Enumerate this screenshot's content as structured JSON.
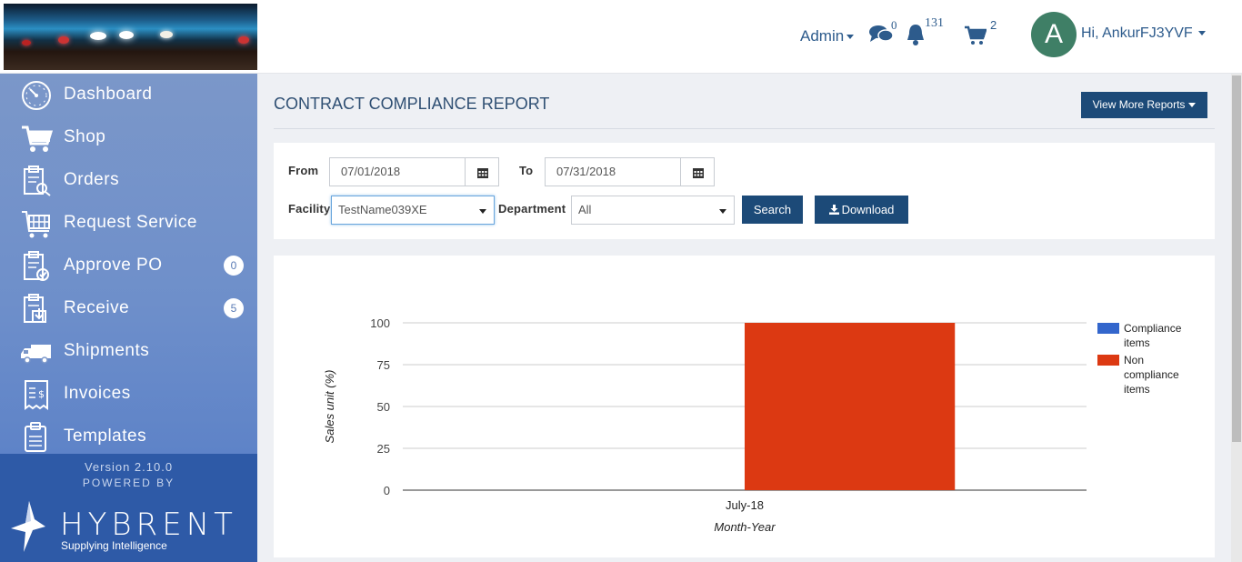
{
  "header": {
    "admin_label": "Admin",
    "messages_count": "0",
    "notifications_count": "131",
    "cart_count": "2",
    "avatar_initial": "A",
    "greeting": "Hi, AnkurFJ3YVF"
  },
  "sidebar": {
    "items": [
      {
        "label": "Dashboard",
        "icon": "dashboard-icon"
      },
      {
        "label": "Shop",
        "icon": "cart-icon"
      },
      {
        "label": "Orders",
        "icon": "orders-icon"
      },
      {
        "label": "Request Service",
        "icon": "request-service-icon"
      },
      {
        "label": "Approve PO",
        "icon": "approve-po-icon",
        "badge": "0"
      },
      {
        "label": "Receive",
        "icon": "receive-icon",
        "badge": "5"
      },
      {
        "label": "Shipments",
        "icon": "truck-icon"
      },
      {
        "label": "Invoices",
        "icon": "invoice-icon"
      },
      {
        "label": "Templates",
        "icon": "templates-icon"
      }
    ],
    "version": "Version 2.10.0",
    "powered_by": "POWERED BY",
    "brand": "HYBRENT",
    "tagline": "Supplying Intelligence"
  },
  "page": {
    "title": "CONTRACT COMPLIANCE REPORT",
    "more_reports_label": "View More Reports"
  },
  "filters": {
    "from_label": "From",
    "from_value": "07/01/2018",
    "to_label": "To",
    "to_value": "07/31/2018",
    "facility_label": "Facility",
    "facility_value": "TestName039XE",
    "department_label": "Department",
    "department_value": "All",
    "search_label": "Search",
    "download_label": "Download"
  },
  "colors": {
    "compliance": "#3366cc",
    "non_compliance": "#dc3912",
    "primary": "#1c4a78"
  },
  "chart_data": {
    "type": "bar",
    "categories": [
      "July-18"
    ],
    "series": [
      {
        "name": "Compliance items",
        "values": [
          0
        ]
      },
      {
        "name": "Non compliance items",
        "values": [
          100
        ]
      }
    ],
    "xlabel": "Month-Year",
    "ylabel": "Sales unit (%)",
    "ylim": [
      0,
      100
    ],
    "yticks": [
      0,
      25,
      50,
      75,
      100
    ],
    "legend": "right",
    "grid": true
  }
}
